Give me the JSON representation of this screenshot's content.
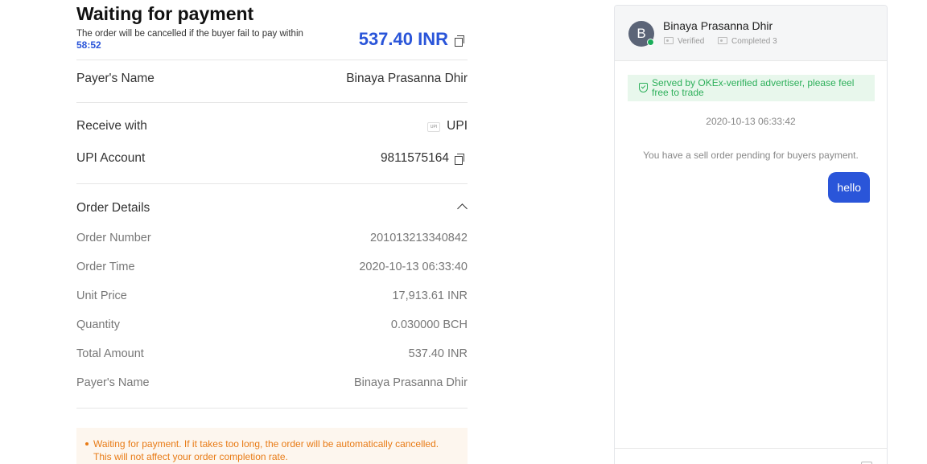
{
  "header": {
    "title": "Waiting for payment",
    "subtitle": "The order will be cancelled if the buyer fail to pay within",
    "countdown": "58:52",
    "amount": "537.40 INR"
  },
  "payer": {
    "label": "Payer's Name",
    "value": "Binaya Prasanna Dhir"
  },
  "payment": {
    "receive_label": "Receive with",
    "receive_method": "UPI",
    "account_label": "UPI Account",
    "account_value": "9811575164"
  },
  "order_details": {
    "title": "Order Details",
    "rows": [
      {
        "label": "Order Number",
        "value": "201013213340842"
      },
      {
        "label": "Order Time",
        "value": "2020-10-13 06:33:40"
      },
      {
        "label": "Unit Price",
        "value": "17,913.61 INR"
      },
      {
        "label": "Quantity",
        "value": "0.030000 BCH"
      },
      {
        "label": "Total Amount",
        "value": "537.40 INR"
      },
      {
        "label": "Payer's Name",
        "value": "Binaya Prasanna Dhir"
      }
    ]
  },
  "notice": {
    "line1": "Waiting for payment. If it takes too long, the order will be automatically cancelled.",
    "line2": "This will not affect your order completion rate."
  },
  "chat": {
    "avatar_letter": "B",
    "user_name": "Binaya Prasanna Dhir",
    "verified_label": "Verified",
    "completed_label": "Completed 3",
    "banner": "Served by OKEx-verified advertiser, please feel free to trade",
    "timestamp": "2020-10-13 06:33:42",
    "system_message": "You have a sell order pending for buyers payment.",
    "messages": [
      {
        "text": "hello",
        "from": "self"
      }
    ]
  },
  "colors": {
    "accent": "#2a55d9",
    "success": "#2eb05b",
    "warning": "#e87b16",
    "online": "#1aad5a"
  }
}
